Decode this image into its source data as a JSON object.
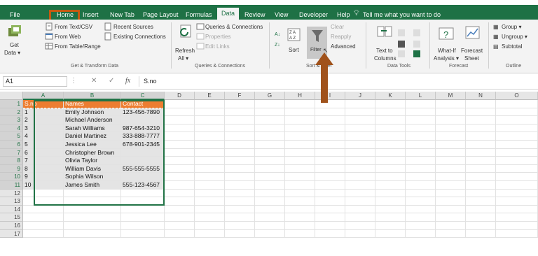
{
  "tabs": [
    {
      "label": "File"
    },
    {
      "label": "Home"
    },
    {
      "label": "Insert"
    },
    {
      "label": "New Tab"
    },
    {
      "label": "Page Layout"
    },
    {
      "label": "Formulas"
    },
    {
      "label": "Data"
    },
    {
      "label": "Review"
    },
    {
      "label": "View"
    },
    {
      "label": "Developer"
    },
    {
      "label": "Help"
    }
  ],
  "tell_me": "Tell me what you want to do",
  "ribbon": {
    "get_data": {
      "line1": "Get",
      "line2": "Data ▾"
    },
    "from_text": "From Text/CSV",
    "from_web": "From Web",
    "from_table": "From Table/Range",
    "recent_sources": "Recent Sources",
    "existing_connections": "Existing Connections",
    "group_get_transform": "Get & Transform Data",
    "refresh": {
      "line1": "Refresh",
      "line2": "All ▾"
    },
    "queries_connections": "Queries & Connections",
    "properties": "Properties",
    "edit_links": "Edit Links",
    "group_queries": "Queries & Connections",
    "sort": "Sort",
    "filter": "Filter",
    "clear": "Clear",
    "reapply": "Reapply",
    "advanced": "Advanced",
    "group_sort_filter": "Sort & Filter",
    "text_to_columns": {
      "line1": "Text to",
      "line2": "Columns"
    },
    "group_data_tools": "Data Tools",
    "what_if": {
      "line1": "What-If",
      "line2": "Analysis ▾"
    },
    "forecast_sheet": {
      "line1": "Forecast",
      "line2": "Sheet"
    },
    "group_forecast": "Forecast",
    "group_btn": "Group ▾",
    "ungroup_btn": "Ungroup ▾",
    "subtotal": "Subtotal",
    "group_outline": "Outline"
  },
  "formula_bar": {
    "name_box": "A1",
    "fx": "fx",
    "content": "S.no",
    "cancel": "✕",
    "enter": "✓"
  },
  "columns": [
    "A",
    "B",
    "C",
    "D",
    "E",
    "F",
    "G",
    "H",
    "I",
    "J",
    "K",
    "L",
    "M",
    "N",
    "O"
  ],
  "rows": [
    "1",
    "2",
    "3",
    "4",
    "5",
    "6",
    "7",
    "8",
    "9",
    "10",
    "11",
    "12",
    "13",
    "14",
    "15",
    "16",
    "17"
  ],
  "table": {
    "headers": [
      "S.no",
      "Names",
      "Contact"
    ],
    "data": [
      [
        "1",
        "Emily Johnson",
        "123-456-7890"
      ],
      [
        "2",
        "Michael Anderson",
        ""
      ],
      [
        "3",
        "Sarah Williams",
        "987-654-3210"
      ],
      [
        "4",
        "Daniel Martinez",
        "333-888-7777"
      ],
      [
        "5",
        "Jessica Lee",
        "678-901-2345"
      ],
      [
        "6",
        "Christopher Brown",
        ""
      ],
      [
        "7",
        "Olivia Taylor",
        ""
      ],
      [
        "8",
        "William Davis",
        "555-555-5555"
      ],
      [
        "9",
        "Sophia Wilson",
        ""
      ],
      [
        "10",
        "James Smith",
        "555-123-4567"
      ]
    ]
  },
  "colors": {
    "excel_green": "#1e7145",
    "highlight_orange": "#ed7d31",
    "annotation_brown": "#a0521b",
    "outline_box": "#c55a11"
  }
}
